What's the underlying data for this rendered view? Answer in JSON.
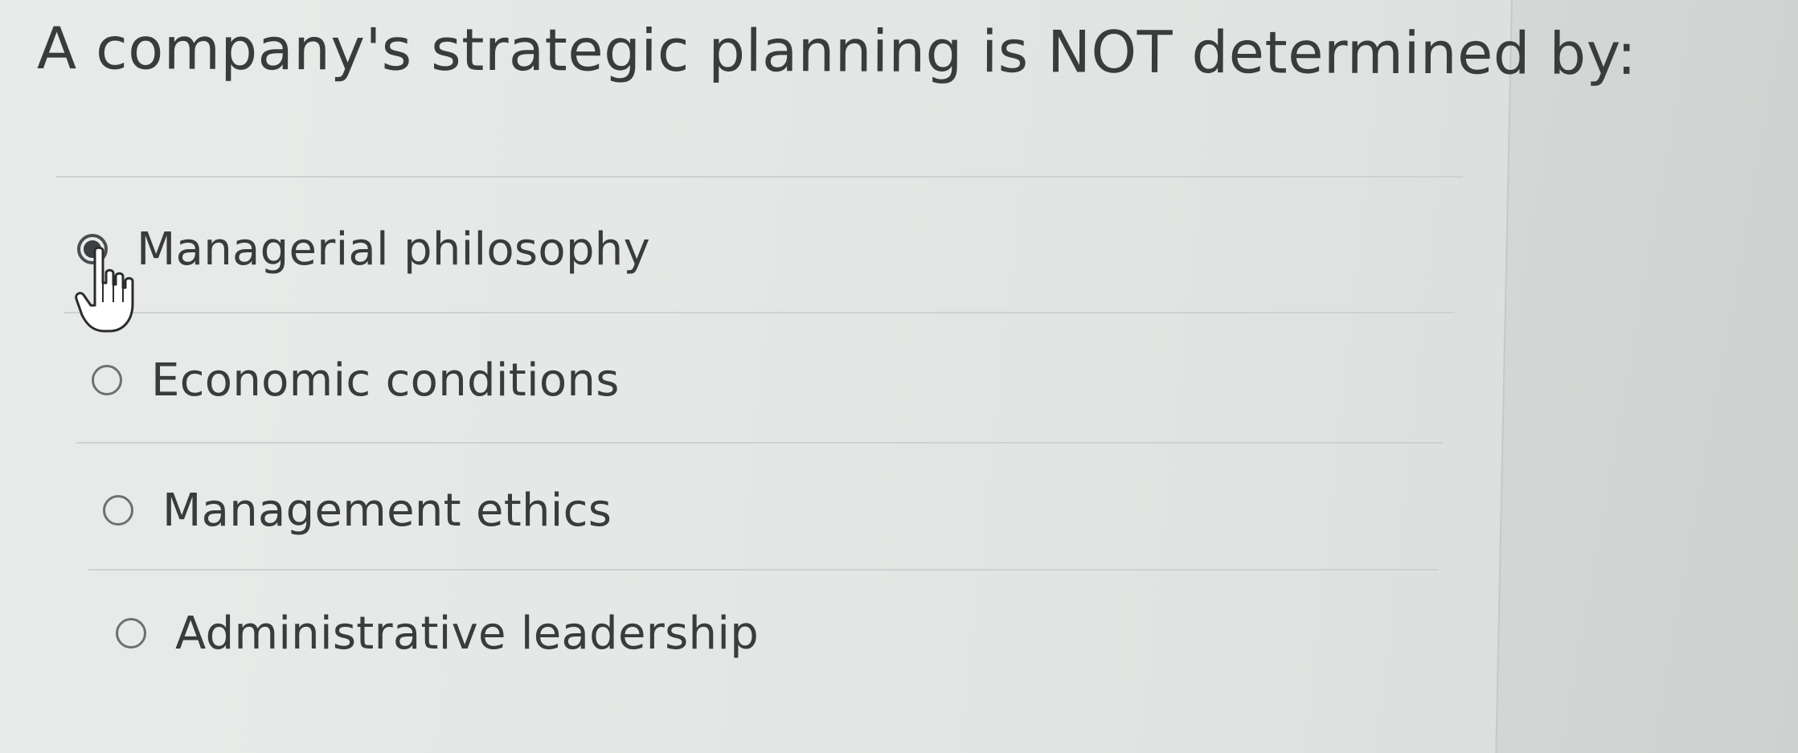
{
  "question": {
    "text": "A company's strategic planning is NOT determined by:"
  },
  "options": [
    {
      "label": "Managerial philosophy",
      "selected": true
    },
    {
      "label": "Economic conditions",
      "selected": false
    },
    {
      "label": "Management ethics",
      "selected": false
    },
    {
      "label": "Administrative leadership",
      "selected": false
    }
  ],
  "cursor": {
    "icon": "hand-pointer-icon"
  }
}
